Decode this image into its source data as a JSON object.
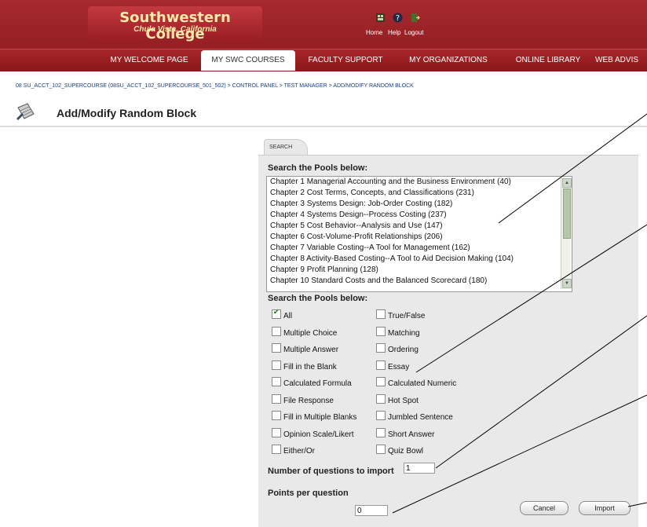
{
  "header": {
    "logo_title": "Southwestern College",
    "logo_subtitle": "Chula Vista, California",
    "top_nav": [
      {
        "label": "Home",
        "icon": "home-icon"
      },
      {
        "label": "Help",
        "icon": "help-icon"
      },
      {
        "label": "Logout",
        "icon": "logout-icon"
      }
    ],
    "tabs": [
      {
        "label": "MY WELCOME PAGE",
        "active": false
      },
      {
        "label": "MY SWC COURSES",
        "active": true
      },
      {
        "label": "FACULTY SUPPORT",
        "active": false
      },
      {
        "label": "MY ORGANIZATIONS",
        "active": false
      },
      {
        "label": "ONLINE LIBRARY",
        "active": false
      },
      {
        "label": "WEB ADVIS",
        "active": false
      }
    ]
  },
  "breadcrumb": "08 SU_ACCT_102_SUPERCOURSE (08SU_ACCT_102_SUPERCOURSE_501_502) > CONTROL PANEL > TEST MANAGER > ADD/MODIFY RANDOM BLOCK",
  "page_title": "Add/Modify Random Block",
  "search_tab_label": "SEARCH",
  "pools": {
    "label": "Search the Pools below:",
    "items": [
      "Chapter 1 Managerial Accounting and the Business Environment (40)",
      "Chapter 2 Cost Terms, Concepts, and Classifications (231)",
      "Chapter 3 Systems Design: Job-Order Costing (182)",
      "Chapter 4 Systems Design--Process Costing (237)",
      "Chapter 5 Cost Behavior--Analysis and Use (147)",
      "Chapter 6 Cost-Volume-Profit Relationships (206)",
      "Chapter 7 Variable Costing--A Tool for Management (162)",
      "Chapter 8 Activity-Based Costing--A Tool to Aid Decision Making (104)",
      "Chapter 9 Profit Planning (128)",
      "Chapter 10 Standard Costs and the Balanced Scorecard (180)"
    ]
  },
  "types": {
    "label": "Search the Pools below:",
    "left": [
      {
        "label": "All",
        "checked": true
      },
      {
        "label": "Multiple Choice",
        "checked": false
      },
      {
        "label": "Multiple Answer",
        "checked": false
      },
      {
        "label": "Fill in the Blank",
        "checked": false
      },
      {
        "label": "Calculated Formula",
        "checked": false
      },
      {
        "label": "File Response",
        "checked": false
      },
      {
        "label": "Fill in Multiple Blanks",
        "checked": false
      },
      {
        "label": "Opinion Scale/Likert",
        "checked": false
      },
      {
        "label": "Either/Or",
        "checked": false
      }
    ],
    "right": [
      {
        "label": "True/False",
        "checked": false
      },
      {
        "label": "Matching",
        "checked": false
      },
      {
        "label": "Ordering",
        "checked": false
      },
      {
        "label": "Essay",
        "checked": false
      },
      {
        "label": "Calculated Numeric",
        "checked": false
      },
      {
        "label": "Hot Spot",
        "checked": false
      },
      {
        "label": "Jumbled Sentence",
        "checked": false
      },
      {
        "label": "Short Answer",
        "checked": false
      },
      {
        "label": "Quiz Bowl",
        "checked": false
      }
    ]
  },
  "form": {
    "num_label": "Number of questions to import",
    "num_value": "1",
    "points_label": "Points per question",
    "points_value": "0"
  },
  "buttons": {
    "cancel": "Cancel",
    "import": "Import"
  },
  "colors": {
    "header": "#a62a2f",
    "panel": "#e9e9e9",
    "link": "#1b3f7a"
  }
}
